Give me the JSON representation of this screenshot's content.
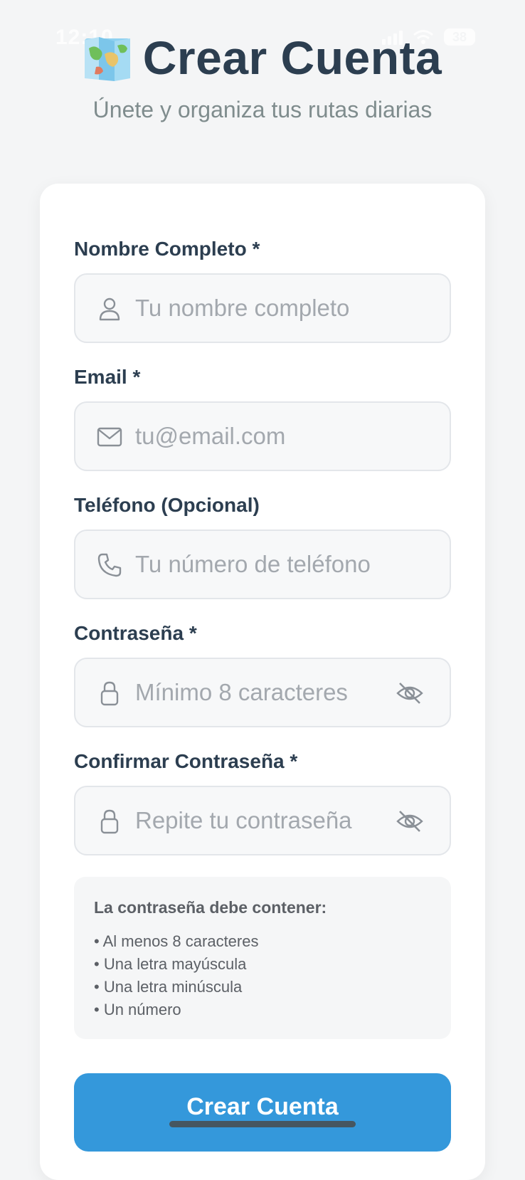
{
  "status_bar": {
    "time": "12:10",
    "battery": "38"
  },
  "header": {
    "title": "Crear Cuenta",
    "subtitle": "Únete y organiza tus rutas diarias"
  },
  "form": {
    "name": {
      "label": "Nombre Completo *",
      "placeholder": "Tu nombre completo",
      "icon": "user-icon"
    },
    "email": {
      "label": "Email *",
      "placeholder": "tu@email.com",
      "icon": "envelope-icon"
    },
    "phone": {
      "label": "Teléfono (Opcional)",
      "placeholder": "Tu número de teléfono",
      "icon": "phone-icon"
    },
    "password": {
      "label": "Contraseña *",
      "placeholder": "Mínimo 8 caracteres",
      "icon": "lock-icon",
      "toggle_icon": "eye-off-icon"
    },
    "confirm_password": {
      "label": "Confirmar Contraseña *",
      "placeholder": "Repite tu contraseña",
      "icon": "lock-icon",
      "toggle_icon": "eye-off-icon"
    }
  },
  "requirements": {
    "title": "La contraseña debe contener:",
    "items": [
      "• Al menos 8 caracteres",
      "• Una letra mayúscula",
      "• Una letra minúscula",
      "• Un número"
    ]
  },
  "submit": {
    "label": "Crear Cuenta"
  },
  "colors": {
    "primary": "#3498db",
    "title": "#2c3e50",
    "subtitle": "#7f8c8d",
    "background": "#f4f5f6"
  }
}
